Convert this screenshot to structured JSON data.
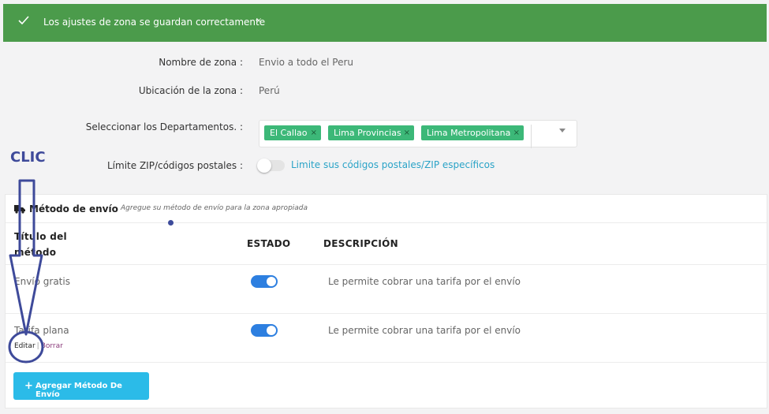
{
  "notice": {
    "message": "Los ajustes de zona se guardan correctamente",
    "close": "×"
  },
  "form": {
    "zone_name_label": "Nombre de zona :",
    "zone_name_value": "Envio a todo el Peru",
    "zone_location_label": "Ubicación de la zona :",
    "zone_location_value": "Perú",
    "departments_label": "Seleccionar los Departamentos. :",
    "departments": [
      {
        "label": "El Callao",
        "remove": "×"
      },
      {
        "label": "Lima Provincias",
        "remove": "×"
      },
      {
        "label": "Lima Metropolitana",
        "remove": "×"
      }
    ],
    "zip_label": "Límite ZIP/códigos postales :",
    "zip_enabled": false,
    "zip_link": "Limite sus códigos postales/ZIP específicos"
  },
  "methods": {
    "title": "Método de envío",
    "subtitle": "Agregue su método de envío para la zona apropiada",
    "columns": {
      "title": "Título del método",
      "status": "ESTADO",
      "description": "DESCRIPCIÓN"
    },
    "rows": [
      {
        "title": "Envío gratis",
        "enabled": true,
        "description": "Le permite cobrar una tarifa por el envío"
      },
      {
        "title": "Tarifa plana",
        "enabled": true,
        "description": "Le permite cobrar una tarifa por el envío",
        "edit": "Editar",
        "sep": "|",
        "delete": "Borrar"
      }
    ],
    "add_button": "Agregar Método De Envío",
    "add_icon": "+"
  },
  "annotation": {
    "label": "CLIC",
    "color": "#3e4a9a"
  },
  "colors": {
    "notice_bg": "#4b9b4b",
    "chip_bg": "#3cb878",
    "toggle_on": "#2d7fe0",
    "button_bg": "#2bbbe8",
    "link": "#2aa3c7"
  }
}
